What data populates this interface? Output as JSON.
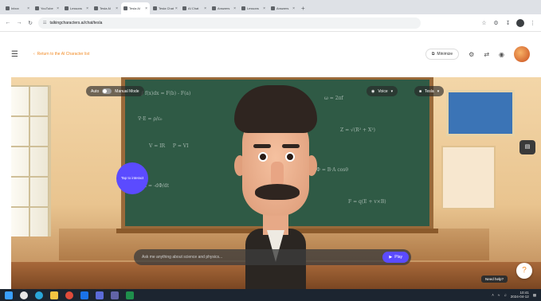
{
  "browser": {
    "tabs": [
      {
        "label": "Inbox"
      },
      {
        "label": "YouTube"
      },
      {
        "label": "Lessons"
      },
      {
        "label": "Tesla AI"
      },
      {
        "label": "Tesla AI"
      },
      {
        "label": "Tesla Chat"
      },
      {
        "label": "AI Chat"
      },
      {
        "label": "Answers"
      },
      {
        "label": "Lessons"
      },
      {
        "label": "Answers"
      }
    ],
    "active_tab_index": 4,
    "url": "talkingcharacters.ai/chat/tesla"
  },
  "app": {
    "back_label": "Return to the AI Character list",
    "minimize_label": "Minimize"
  },
  "overlay": {
    "auto_label": "Auto",
    "toggle_label": "Manual Mode",
    "voice_label": "Voice",
    "character_label": "Tesla"
  },
  "hint": {
    "text": "Tap to interact"
  },
  "chat": {
    "placeholder": "Ask me anything about science and physics...",
    "play_label": "Play"
  },
  "help": {
    "tooltip": "Need help?"
  },
  "colors": {
    "accent": "#5b4bff",
    "brand": "#f28c28",
    "board": "#2f5a45"
  },
  "taskbar": {
    "time": "10:41",
    "date": "2024-04-12",
    "apps": [
      "start-icon",
      "search-icon",
      "edge-icon",
      "files-icon",
      "chrome-icon",
      "mail-icon",
      "store-icon",
      "teams-icon",
      "excel-icon"
    ]
  }
}
